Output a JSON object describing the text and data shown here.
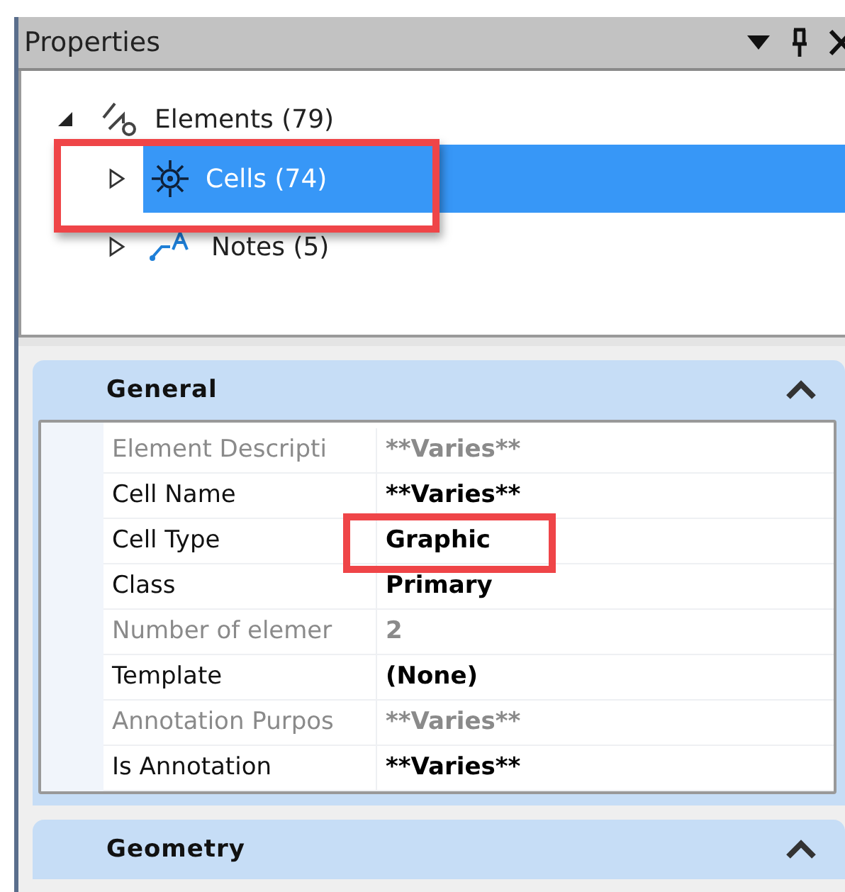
{
  "panel": {
    "title": "Properties"
  },
  "tree": [
    {
      "label": "Elements (79)",
      "kind": "elements",
      "expanded": true,
      "selected": false,
      "children": [
        {
          "label": "Cells (74)",
          "kind": "cell",
          "expanded": false,
          "selected": true
        },
        {
          "label": "Notes (5)",
          "kind": "note",
          "expanded": false,
          "selected": false
        }
      ]
    }
  ],
  "sections": [
    {
      "title": "General",
      "expanded": true,
      "rows": [
        {
          "label": "Element Descripti",
          "value": "**Varies**",
          "disabled": true
        },
        {
          "label": "Cell Name",
          "value": "**Varies**",
          "disabled": false
        },
        {
          "label": "Cell Type",
          "value": "Graphic",
          "disabled": false
        },
        {
          "label": "Class",
          "value": "Primary",
          "disabled": false
        },
        {
          "label": "Number of elemer",
          "value": "2",
          "disabled": true
        },
        {
          "label": "Template",
          "value": "(None)",
          "disabled": false
        },
        {
          "label": "Annotation Purpos",
          "value": "**Varies**",
          "disabled": true
        },
        {
          "label": "Is Annotation",
          "value": "**Varies**",
          "disabled": false
        }
      ]
    },
    {
      "title": "Geometry",
      "expanded": true
    }
  ]
}
